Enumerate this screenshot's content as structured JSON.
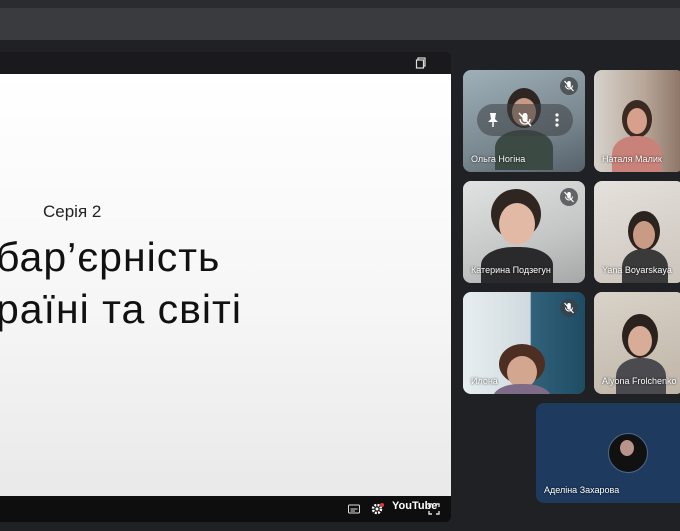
{
  "presentation": {
    "series": "Серія 2",
    "title_line1": "бар’єрність",
    "title_line2": "раїні та світі",
    "youtube_label": "YouTube"
  },
  "participants": [
    {
      "name": "Ольга Ногіна",
      "muted": true
    },
    {
      "name": "Наталя Малик",
      "muted": false
    },
    {
      "name": "Катерина Подзегун",
      "muted": true
    },
    {
      "name": "Yana Boyarskaya",
      "muted": false
    },
    {
      "name": "Илона",
      "muted": true
    },
    {
      "name": "Alyona Frolchenko",
      "muted": false
    },
    {
      "name": "Аделіна Захарова",
      "muted": false
    }
  ],
  "colors": {
    "background": "#202124",
    "tile_self": "#1e3a5f",
    "slide": "#ffffff"
  },
  "icons": [
    "copy-icon",
    "mic-off-icon",
    "pin-icon",
    "more-vert-icon",
    "subtitles-icon",
    "settings-icon",
    "fullscreen-icon"
  ]
}
